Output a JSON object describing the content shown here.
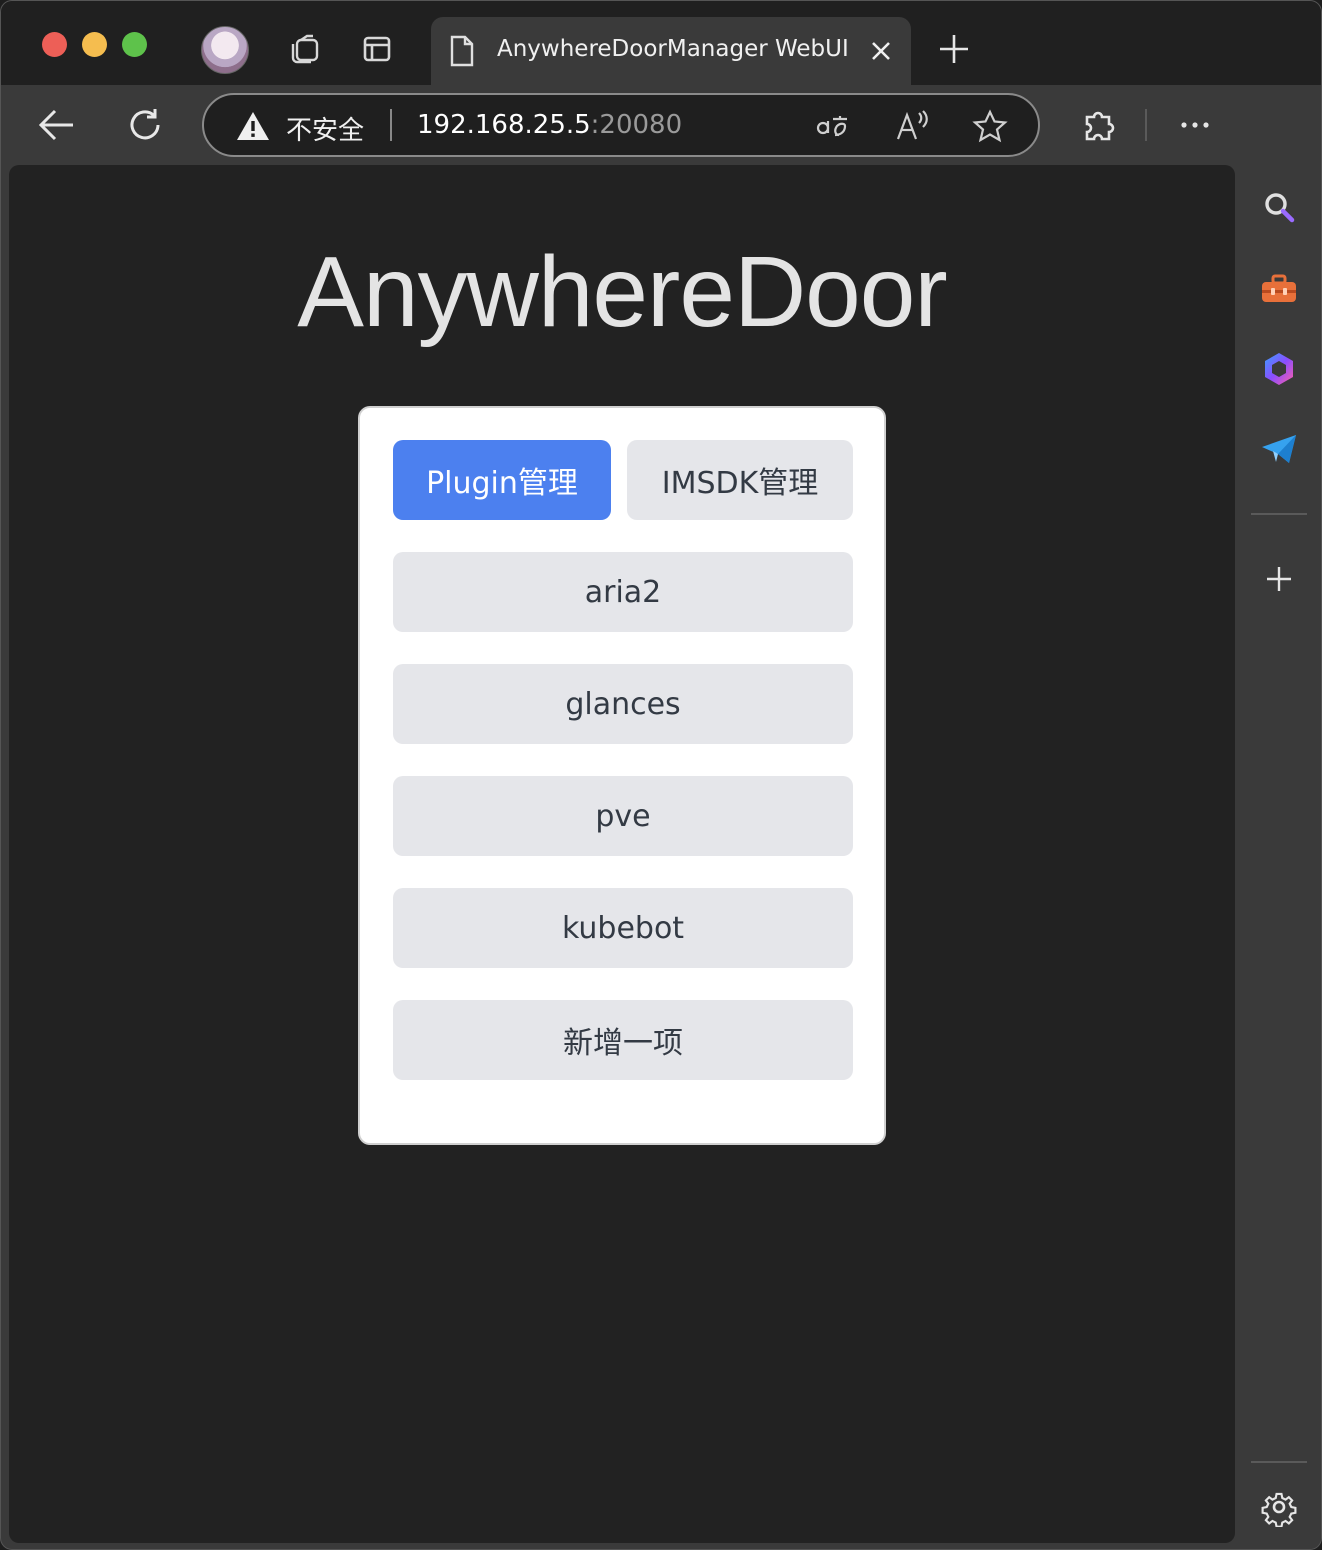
{
  "browser": {
    "tab_title": "AnywhereDoorManager WebUI",
    "security_label": "不安全",
    "url_host": "192.168.25.5",
    "url_port": ":20080"
  },
  "page": {
    "brand": "AnywhereDoor",
    "tabs": [
      {
        "label": "Plugin管理",
        "active": true
      },
      {
        "label": "IMSDK管理",
        "active": false
      }
    ],
    "items": [
      {
        "label": "aria2"
      },
      {
        "label": "glances"
      },
      {
        "label": "pve"
      },
      {
        "label": "kubebot"
      },
      {
        "label": "新增一项"
      }
    ]
  },
  "colors": {
    "accent": "#4c80ef",
    "button_bg": "#e5e6ea",
    "page_bg": "#222222"
  },
  "icons": {
    "toolbar": [
      "back-icon",
      "refresh-icon",
      "warning-icon",
      "translate-icon",
      "read-aloud-icon",
      "favorite-star-icon",
      "extensions-icon",
      "more-icon",
      "copilot-icon"
    ],
    "sidebar": [
      "search-icon",
      "toolbox-icon",
      "office-icon",
      "telegram-icon",
      "add-icon",
      "settings-gear-icon"
    ]
  }
}
